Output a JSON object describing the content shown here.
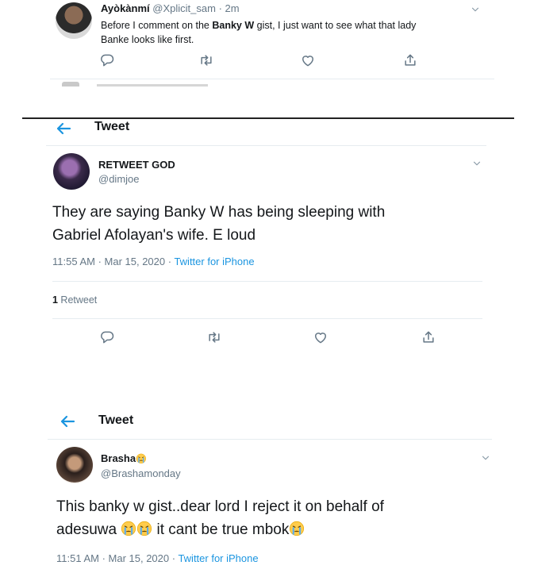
{
  "top_tweet": {
    "display_name": "Ayòkànmí",
    "handle": "@Xplicit_sam",
    "separator": "·",
    "time": "2m",
    "text_before": "Before I comment on the ",
    "text_bold": "Banky W",
    "text_after": " gist, I just want to see what that lady",
    "text_line2": "Banke looks like first."
  },
  "tweet1": {
    "header": "Tweet",
    "display_name": "RETWEET GOD",
    "handle": "@dimjoe",
    "text_line1": "They are saying Banky W has being sleeping with",
    "text_line2": "Gabriel Afolayan's wife. E loud",
    "timestamp": "11:55 AM · Mar 15, 2020 · ",
    "source": "Twitter for iPhone",
    "retweet_count": "1",
    "retweet_label": " Retweet"
  },
  "tweet2": {
    "header": "Tweet",
    "display_name": "Brasha",
    "handle": "@Brashamonday",
    "text_line1": "This banky w gist..dear lord I reject it on behalf of",
    "text_line2_a": "adesuwa ",
    "text_line2_b": " it cant be true mbok",
    "timestamp": "11:51 AM · Mar 15, 2020 · ",
    "source": "Twitter for iPhone"
  },
  "colors": {
    "accent": "#1b95e0",
    "muted": "#657786",
    "text": "#14171a",
    "divider": "#e6ecf0"
  },
  "icons": [
    "reply-icon",
    "retweet-icon",
    "like-icon",
    "share-icon",
    "chevron-down-icon",
    "back-arrow-icon",
    "crying-face-emoji"
  ]
}
